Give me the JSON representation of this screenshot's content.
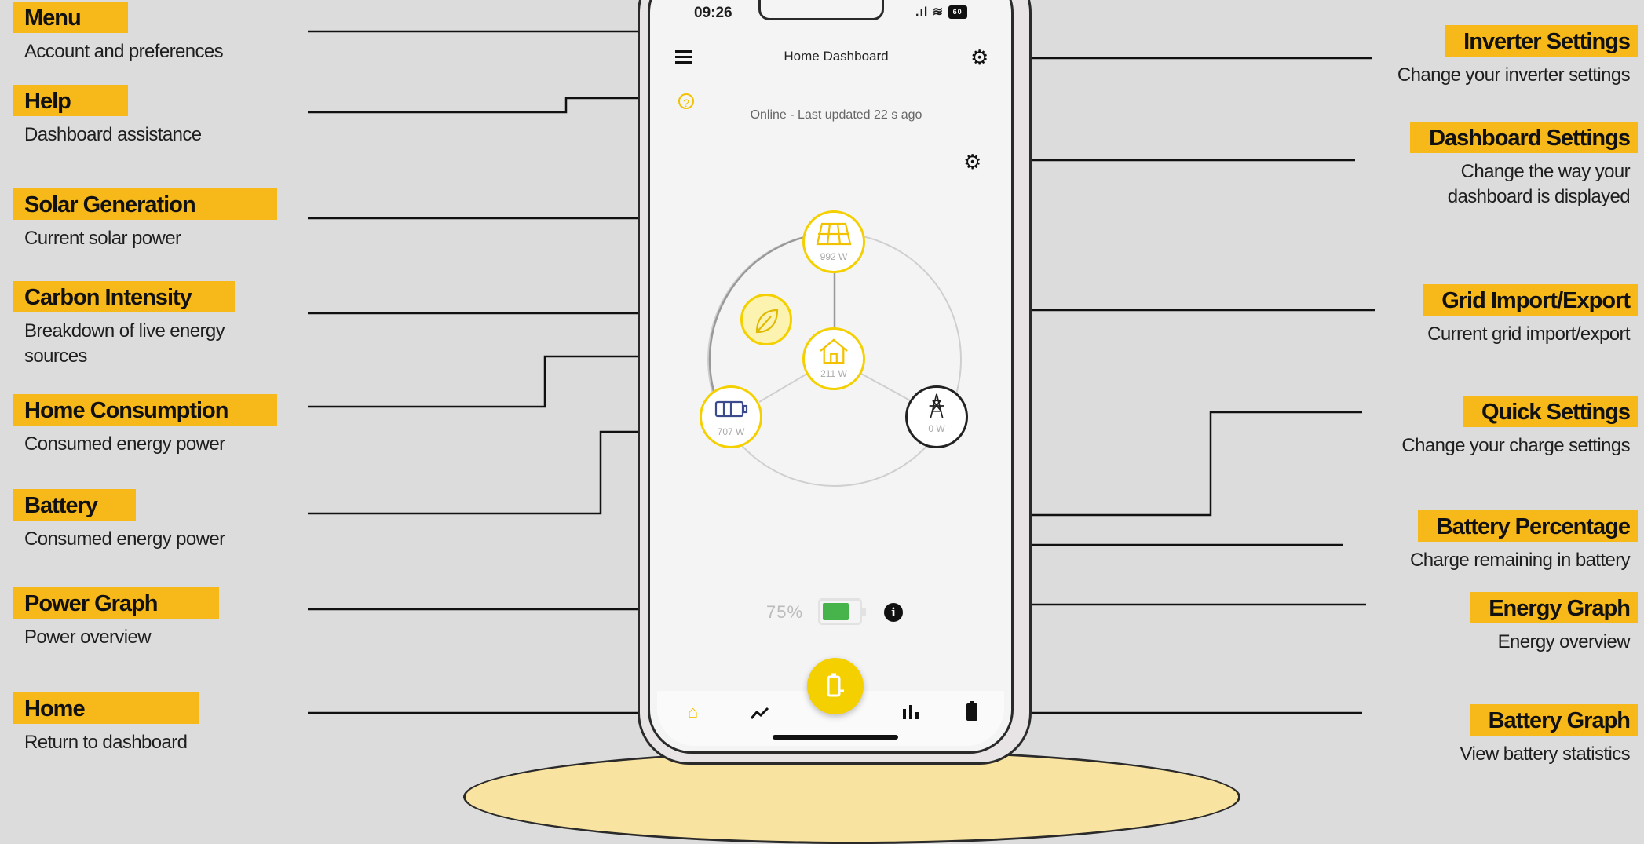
{
  "left_labels": [
    {
      "title": "Menu",
      "desc": "Account and preferences"
    },
    {
      "title": "Help",
      "desc": "Dashboard assistance"
    },
    {
      "title": "Solar Generation",
      "desc": "Current solar power"
    },
    {
      "title": "Carbon Intensity",
      "desc": "Breakdown of live energy sources"
    },
    {
      "title": "Home Consumption",
      "desc": "Consumed energy power"
    },
    {
      "title": "Battery",
      "desc": "Consumed energy power"
    },
    {
      "title": "Power Graph",
      "desc": "Power overview"
    },
    {
      "title": "Home",
      "desc": "Return to dashboard"
    }
  ],
  "right_labels": [
    {
      "title": "Inverter Settings",
      "desc": "Change your inverter settings"
    },
    {
      "title": "Dashboard Settings",
      "desc": "Change the way your dashboard is displayed"
    },
    {
      "title": "Grid Import/Export",
      "desc": "Current grid import/export"
    },
    {
      "title": "Quick Settings",
      "desc": "Change your charge settings"
    },
    {
      "title": "Battery Percentage",
      "desc": "Charge remaining in battery"
    },
    {
      "title": "Energy Graph",
      "desc": "Energy overview"
    },
    {
      "title": "Battery Graph",
      "desc": "View battery statistics"
    }
  ],
  "phone": {
    "time": "09:26",
    "signal": ".ıl",
    "wifi": "≋",
    "battery_badge": "60",
    "screen_title": "Home Dashboard",
    "help_glyph": "?",
    "online_status": "Online - Last updated 22 s ago",
    "solar_value": "992 W",
    "home_value": "211 W",
    "battery_value": "707 W",
    "grid_value": "0 W",
    "battery_percent": "75%",
    "battery_level": 0.75,
    "info_glyph": "i"
  },
  "icons": {
    "menu": "hamburger-icon",
    "settings": "gear-icon",
    "help": "question-circle-icon",
    "solar": "solar-panel-icon",
    "carbon": "leaf-icon",
    "home": "house-icon",
    "battery": "battery-icon",
    "grid": "pylon-icon",
    "info": "info-circle-icon",
    "nav_home": "home-icon",
    "nav_power": "trend-line-icon",
    "nav_quick": "charge-icon",
    "nav_energy": "bar-chart-icon",
    "nav_battery": "battery-icon"
  },
  "colors": {
    "accent": "#f7b81a",
    "node_yellow": "#f5d000",
    "battery_fill": "#46b34b",
    "background": "#dcdcdc"
  }
}
